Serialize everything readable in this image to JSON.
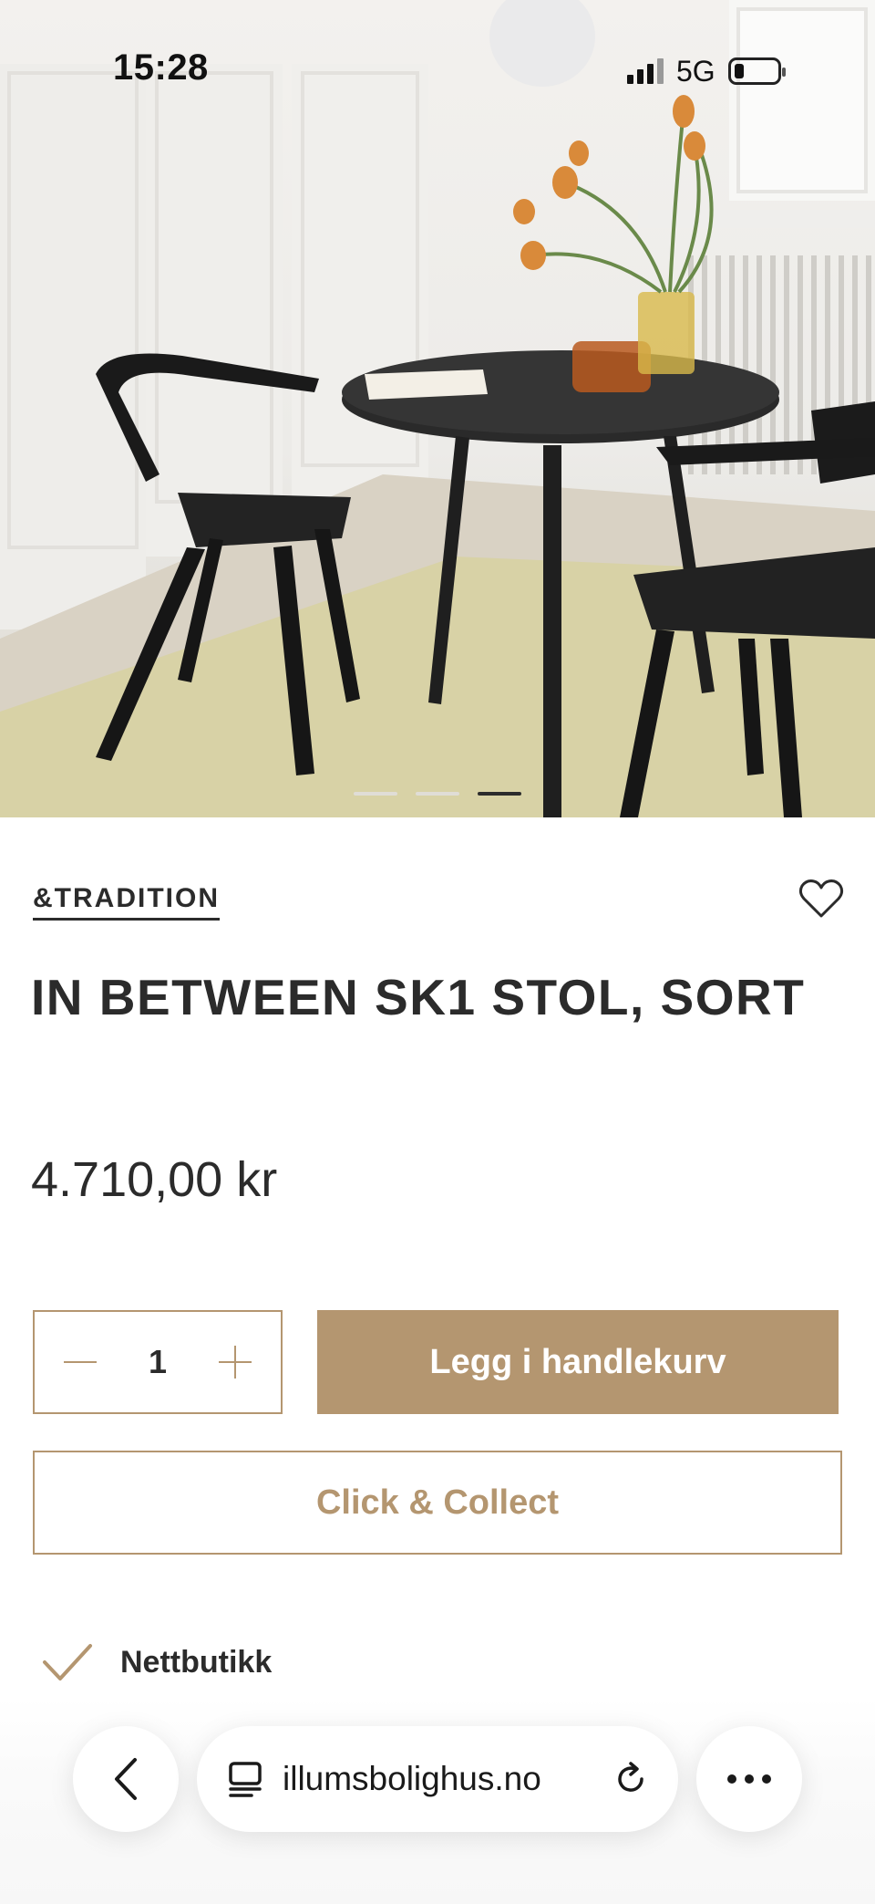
{
  "status_bar": {
    "time": "15:28",
    "network": "5G"
  },
  "hero": {
    "image_description_icon": "dining-set-photo",
    "carousel": {
      "count": 3,
      "active_index": 2
    }
  },
  "product": {
    "brand": "&TRADITION",
    "title": "IN BETWEEN SK1 STOL, SORT",
    "price": "4.710,00 kr",
    "quantity": "1"
  },
  "actions": {
    "add_to_cart": "Legg i handlekurv",
    "click_collect": "Click & Collect"
  },
  "availability": {
    "label": "Nettbutikk"
  },
  "browser": {
    "url": "illumsbolighus.no"
  },
  "colors": {
    "accent": "#b49670",
    "text": "#2b2b2b"
  }
}
